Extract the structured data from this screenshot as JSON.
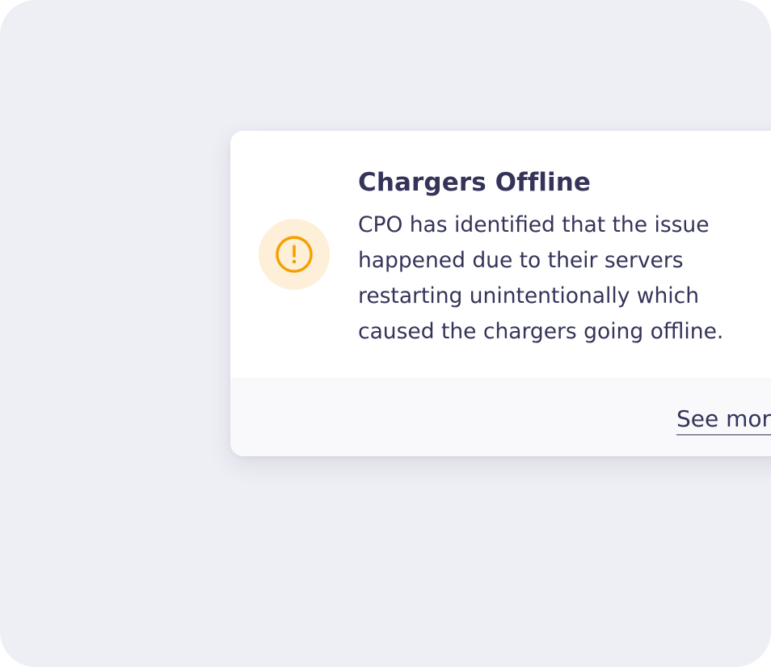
{
  "notification": {
    "icon": "alert-circle-icon",
    "accent_color": "#f5a000",
    "icon_background": "#fdefd8",
    "title": "Chargers Offline",
    "message": "CPO has identified that the issue\nhappened due to their servers\nrestarting unintentionally which\ncaused the chargers going offline.",
    "link_label": "See more"
  }
}
